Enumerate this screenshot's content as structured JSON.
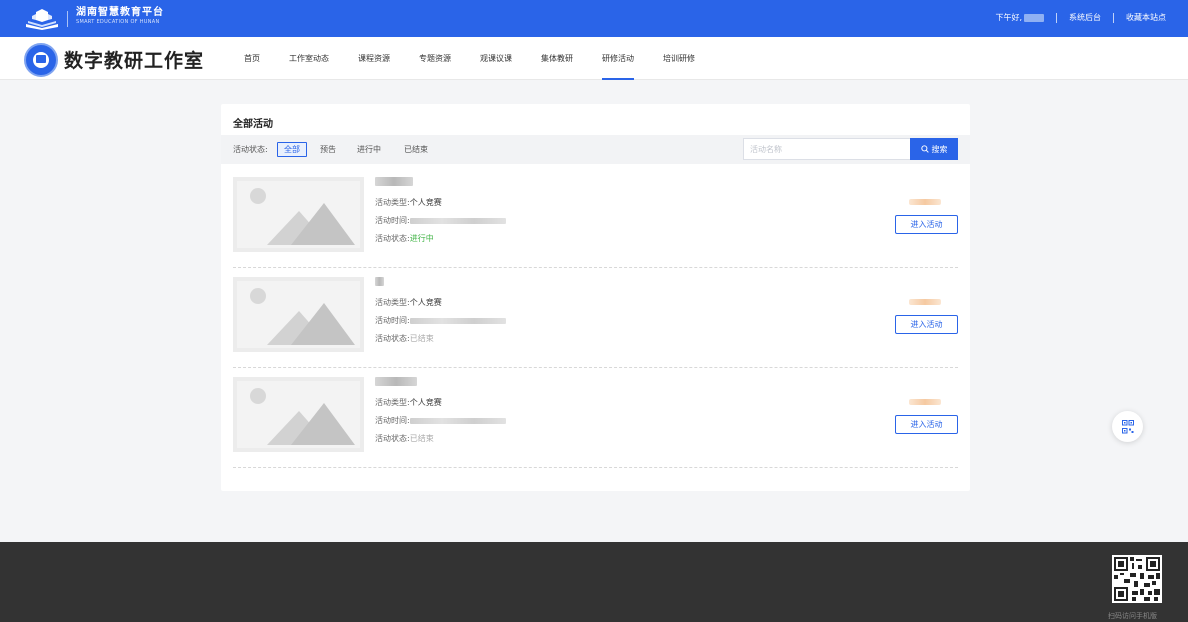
{
  "topbar": {
    "platform_name": "湖南智慧教育平台",
    "platform_name_en": "SMART EDUCATION OF HUNAN",
    "greeting": "下午好,",
    "admin_link": "系统后台",
    "bookmark_link": "收藏本站点",
    "bg_color": "#2a64e8"
  },
  "header": {
    "studio_title": "数字教研工作室",
    "nav": [
      {
        "label": "首页"
      },
      {
        "label": "工作室动态"
      },
      {
        "label": "课程资源"
      },
      {
        "label": "专题资源"
      },
      {
        "label": "观课议课"
      },
      {
        "label": "集体教研"
      },
      {
        "label": "研修活动",
        "active": true
      },
      {
        "label": "培训研修"
      }
    ]
  },
  "main": {
    "section_title": "全部活动",
    "filter": {
      "label": "活动状态:",
      "options": [
        {
          "label": "全部",
          "active": true
        },
        {
          "label": "预告"
        },
        {
          "label": "进行中"
        },
        {
          "label": "已结束"
        }
      ]
    },
    "search": {
      "placeholder": "活动名称",
      "value": "",
      "button_label": "搜索",
      "button_icon": "search-icon"
    },
    "activities": [
      {
        "type_label": "活动类型:",
        "type_value": "个人竞赛",
        "time_label": "活动时间:",
        "status_label": "活动状态:",
        "status_value": "进行中",
        "status_color": "#44b549",
        "enter_label": "进入活动"
      },
      {
        "type_label": "活动类型:",
        "type_value": "个人竞赛",
        "time_label": "活动时间:",
        "status_label": "活动状态:",
        "status_value": "已结束",
        "status_color": "#aaaaaa",
        "enter_label": "进入活动"
      },
      {
        "type_label": "活动类型:",
        "type_value": "个人竞赛",
        "time_label": "活动时间:",
        "status_label": "活动状态:",
        "status_value": "已结束",
        "status_color": "#aaaaaa",
        "enter_label": "进入活动"
      }
    ]
  },
  "footer": {
    "qr_caption": "扫码访问手机版"
  }
}
